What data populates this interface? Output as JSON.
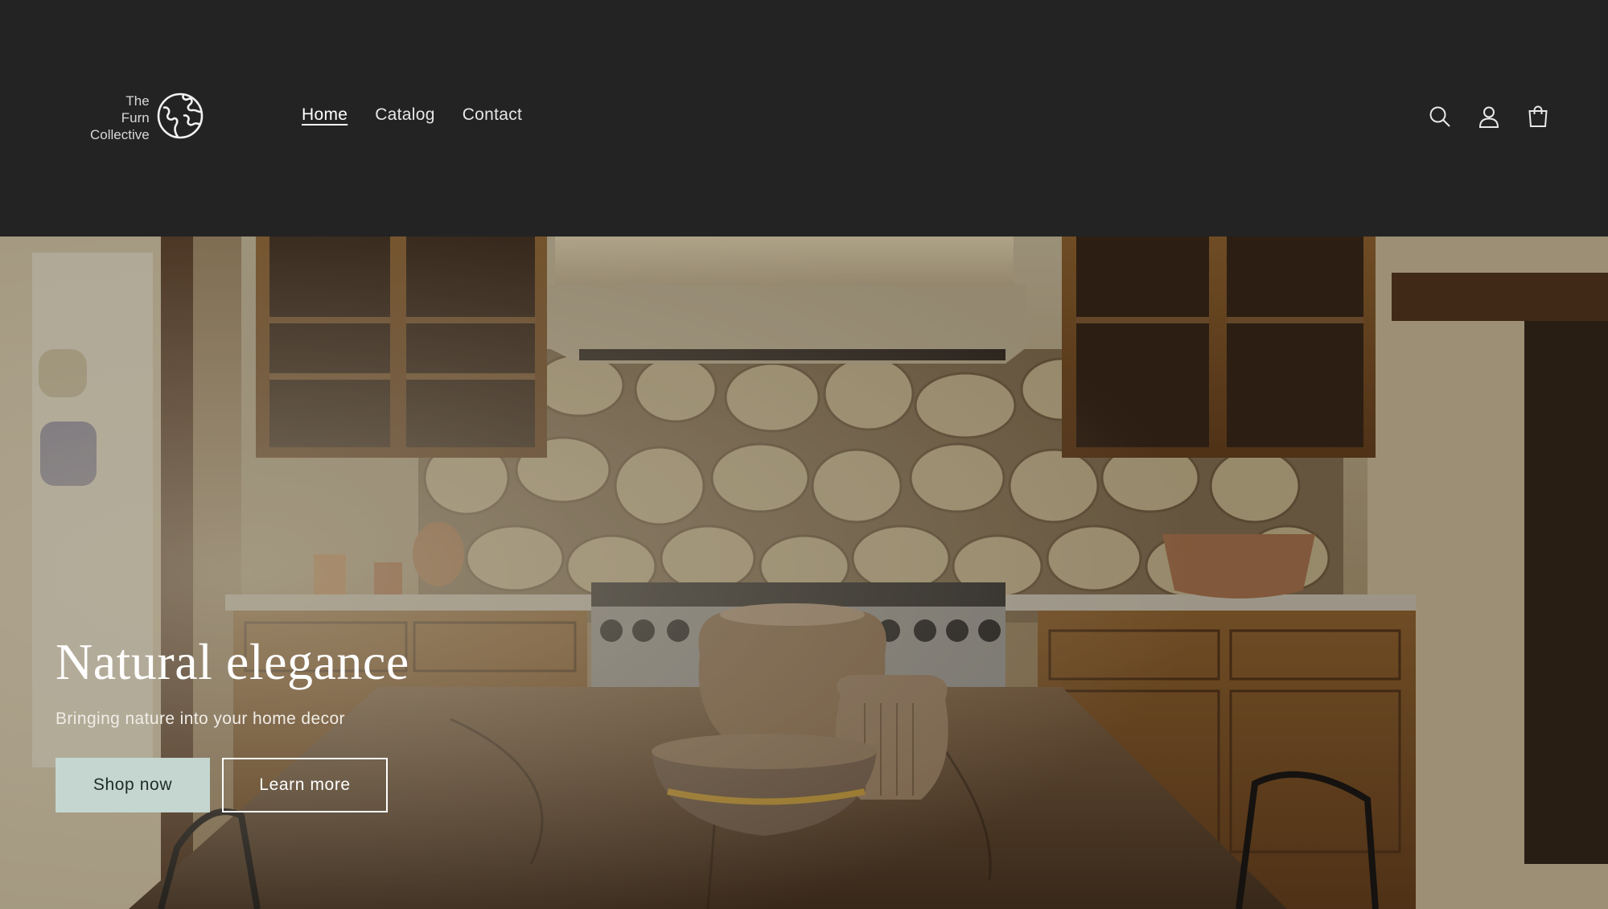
{
  "header": {
    "logo": {
      "line1": "The",
      "line2": "Furn",
      "line3": "Collective",
      "icon": "globe-icon"
    },
    "nav": [
      {
        "label": "Home",
        "active": true
      },
      {
        "label": "Catalog",
        "active": false
      },
      {
        "label": "Contact",
        "active": false
      }
    ],
    "icons": [
      "search-icon",
      "account-icon",
      "cart-icon"
    ]
  },
  "hero": {
    "title": "Natural elegance",
    "subtitle": "Bringing nature into your home decor",
    "primary_button": "Shop now",
    "secondary_button": "Learn more",
    "image": "kitchen-scene"
  },
  "colors": {
    "header_bg": "#232323",
    "primary_button_bg": "#c4d6cf",
    "text_light": "#ffffff"
  }
}
